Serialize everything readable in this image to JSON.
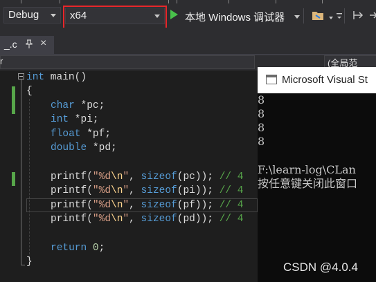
{
  "toolbar": {
    "config": "Debug",
    "platform": "x64",
    "debugger": "本地 Windows 调试器",
    "play_icon": "play-icon",
    "folder_icon": "folder-icon",
    "overflow_icon": "overflow-icon"
  },
  "tab": {
    "filename": "_.c",
    "close": "×",
    "pin_icon": "pin-icon"
  },
  "navbar": {
    "left": "r",
    "right": "(全局范"
  },
  "editor": {
    "lines": [
      {
        "l1": "int",
        "l2": " main()"
      },
      {
        "t": "{"
      },
      {
        "kw": "char",
        "rest": " *pc;"
      },
      {
        "kw": "int",
        "rest": " *pi;"
      },
      {
        "kw": "float",
        "rest": " *pf;"
      },
      {
        "kw": "double",
        "rest": " *pd;"
      },
      {
        "fn": "printf(",
        "str": "\"%d",
        "esc": "\\n",
        "str2": "\"",
        "sep": ", ",
        "kw": "sizeof",
        "arg": "(pc)); ",
        "cm": "// 4"
      },
      {
        "fn": "printf(",
        "str": "\"%d",
        "esc": "\\n",
        "str2": "\"",
        "sep": ", ",
        "kw": "sizeof",
        "arg": "(pi)); ",
        "cm": "// 4"
      },
      {
        "fn": "printf(",
        "str": "\"%d",
        "esc": "\\n",
        "str2": "\"",
        "sep": ", ",
        "kw": "sizeof",
        "arg": "(pf)); ",
        "cm": "// 4"
      },
      {
        "fn": "printf(",
        "str": "\"%d",
        "esc": "\\n",
        "str2": "\"",
        "sep": ", ",
        "kw": "sizeof",
        "arg": "(pd)); ",
        "cm": "// 4"
      },
      {
        "kw": "return",
        "rest": " ",
        "num": "0",
        "rest2": ";"
      },
      {
        "t": "}"
      }
    ]
  },
  "console": {
    "title": "Microsoft Visual St",
    "output": [
      "8",
      "8",
      "8",
      "8"
    ],
    "path": "F:\\learn-log\\CLan",
    "prompt": "按任意键关闭此窗口"
  },
  "watermark": "CSDN @4.0.4",
  "colors": {
    "highlight_border": "#e8262a",
    "play": "#49c14b",
    "keyword": "#569cd6",
    "string": "#d69d85",
    "comment": "#57a64a"
  }
}
